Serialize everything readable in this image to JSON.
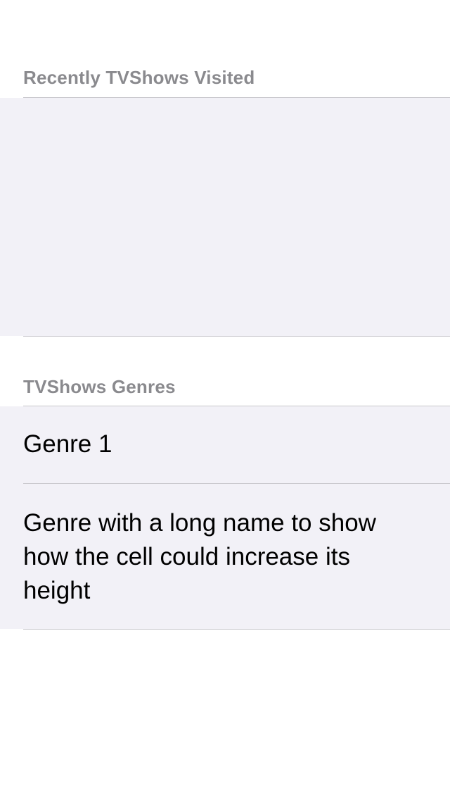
{
  "sections": {
    "recent": {
      "header": "Recently TVShows Visited"
    },
    "genres": {
      "header": "TVShows Genres",
      "items": [
        {
          "label": "Genre 1"
        },
        {
          "label": "Genre with a long name to show how the cell could increase its height"
        }
      ]
    }
  }
}
